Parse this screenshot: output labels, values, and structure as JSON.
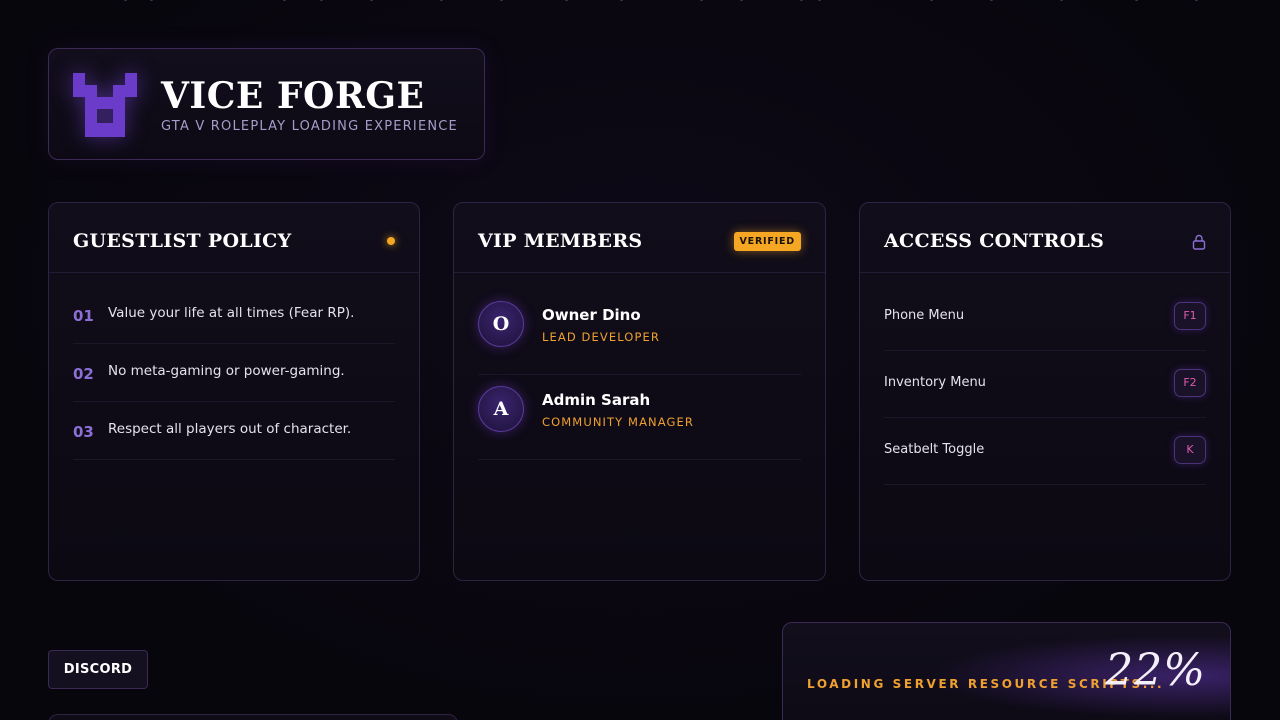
{
  "brand": {
    "title": "VICE FORGE",
    "subtitle": "GTA V ROLEPLAY LOADING EXPERIENCE",
    "logo_icon": "pixel-v-logo-icon",
    "accent_color": "#6f3fd1"
  },
  "guestlist": {
    "title": "GUESTLIST POLICY",
    "status_dot_color": "#f5a623",
    "rules": [
      {
        "num": "01",
        "text": "Value your life at all times (Fear RP)."
      },
      {
        "num": "02",
        "text": "No meta-gaming or power-gaming."
      },
      {
        "num": "03",
        "text": "Respect all players out of character."
      }
    ]
  },
  "vip": {
    "title": "VIP MEMBERS",
    "badge": "VERIFIED",
    "members": [
      {
        "initial": "O",
        "name": "Owner Dino",
        "role": "LEAD DEVELOPER"
      },
      {
        "initial": "A",
        "name": "Admin Sarah",
        "role": "COMMUNITY MANAGER"
      }
    ]
  },
  "controls": {
    "title": "ACCESS CONTROLS",
    "icon": "lock-icon",
    "items": [
      {
        "label": "Phone Menu",
        "key": "F1"
      },
      {
        "label": "Inventory Menu",
        "key": "F2"
      },
      {
        "label": "Seatbelt Toggle",
        "key": "K"
      }
    ]
  },
  "footer": {
    "discord_label": "DISCORD"
  },
  "loading": {
    "status_text": "LOADING SERVER RESOURCE SCRIPTS...",
    "percent_label": "22%",
    "progress": 0.22,
    "accent_color": "#f0a030"
  }
}
